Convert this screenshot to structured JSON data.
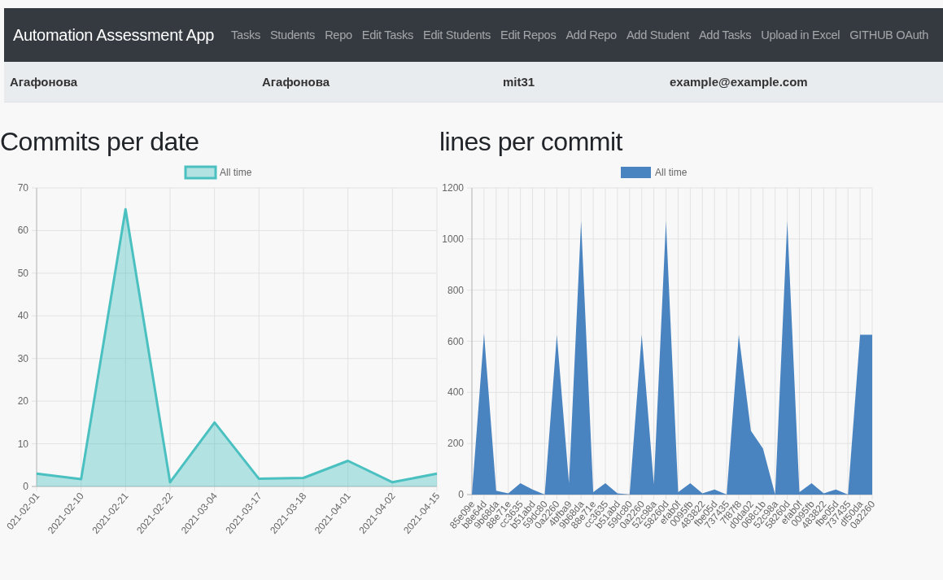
{
  "navbar": {
    "brand": "Automation Assessment App",
    "links": [
      "Tasks",
      "Students",
      "Repo",
      "Edit Tasks",
      "Edit Students",
      "Edit Repos",
      "Add Repo",
      "Add Student",
      "Add Tasks",
      "Upload in Excel",
      "GITHUB OAuth"
    ]
  },
  "user_bar": [
    "Агафонова",
    "Агафонова",
    "mit31",
    "example@example.com"
  ],
  "panels": [
    {
      "title": "Commits per date",
      "chart_data": {
        "type": "area",
        "grid": true,
        "categories": [
          "021-02-01",
          "2021-02-10",
          "2021-02-21",
          "2021-02-22",
          "2021-03-04",
          "2021-03-17",
          "2021-03-18",
          "2021-04-01",
          "2021-04-02",
          "2021-04-15"
        ],
        "ylim": [
          0,
          70
        ],
        "yticks": [
          0,
          10,
          20,
          30,
          40,
          50,
          60,
          70
        ],
        "series": [
          {
            "name": "All time",
            "color": "#4bc0c0",
            "values": [
              3,
              1.7,
              65,
              1,
              15,
              1.8,
              2,
              6,
              1,
              3
            ]
          }
        ]
      }
    },
    {
      "title": "lines per commit",
      "chart_data": {
        "type": "area",
        "grid": true,
        "categories": [
          "85e09e",
          "b8e64d",
          "9b68da",
          "88e71e",
          "cc3635",
          "b51abd",
          "59dc80",
          "0a2260",
          "4bfba9",
          "9b68da",
          "88e71e",
          "cc3635",
          "b51abd",
          "59dc80",
          "0a2260",
          "52c98a",
          "58260d",
          "efab0f",
          "0095fb",
          "483822",
          "fbe05d",
          "737435",
          "7f87f8",
          "d0da02",
          "068c1b",
          "52c98a",
          "58260d",
          "efab0f",
          "0095fb",
          "483822",
          "fbe05d",
          "737435",
          "df50da",
          "0a2260"
        ],
        "ylim": [
          0,
          1200
        ],
        "yticks": [
          0,
          200,
          400,
          600,
          800,
          1000,
          1200
        ],
        "series": [
          {
            "name": "All time",
            "color": "#4a84c0",
            "values": [
              0,
              630,
              15,
              5,
              45,
              20,
              0,
              625,
              45,
              1070,
              10,
              45,
              5,
              0,
              625,
              40,
              1070,
              10,
              45,
              5,
              20,
              0,
              625,
              250,
              180,
              0,
              1070,
              10,
              45,
              5,
              20,
              0,
              625,
              625
            ]
          }
        ]
      }
    }
  ]
}
